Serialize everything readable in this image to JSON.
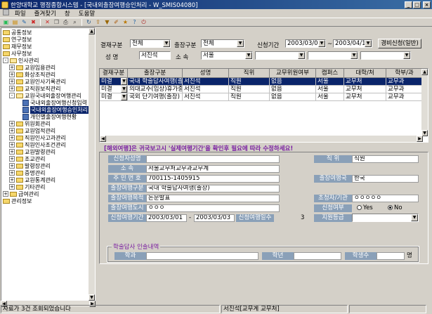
{
  "window": {
    "title": "한양대학교 행정종합시스템 - [국내외출장여행승인처리 - W_SMIS04080]"
  },
  "menu": {
    "items": [
      "파일",
      "즐겨찾기",
      "창",
      "도움말"
    ]
  },
  "toolbar": {
    "icons": [
      "new-icon",
      "open-icon",
      "pencil-icon",
      "delete-icon",
      "close-icon",
      "copy-icon",
      "print-icon",
      "search-icon",
      "refresh-icon",
      "export-icon",
      "filter-icon",
      "edit-icon",
      "bookmark-icon",
      "help-icon",
      "exit-icon"
    ]
  },
  "tree": {
    "items": [
      {
        "label": "공통정보",
        "level": 0,
        "kind": "folder",
        "expander": ""
      },
      {
        "label": "연구정보",
        "level": 0,
        "kind": "folder",
        "expander": ""
      },
      {
        "label": "재무정보",
        "level": 0,
        "kind": "folder",
        "expander": ""
      },
      {
        "label": "사무정보",
        "level": 0,
        "kind": "folder",
        "expander": ""
      },
      {
        "label": "인사관리",
        "level": 0,
        "kind": "folder-open",
        "expander": "-"
      },
      {
        "label": "교원임용관리",
        "level": 1,
        "kind": "folder",
        "expander": "+"
      },
      {
        "label": "화상조직관리",
        "level": 1,
        "kind": "folder",
        "expander": "+"
      },
      {
        "label": "교원인사기록관리",
        "level": 1,
        "kind": "folder",
        "expander": "+"
      },
      {
        "label": "교직원보직관리",
        "level": 1,
        "kind": "folder",
        "expander": "+"
      },
      {
        "label": "교원국내외출장여행관리",
        "level": 1,
        "kind": "folder-open",
        "expander": "-"
      },
      {
        "label": "국내외출장여행신청입력",
        "level": 2,
        "kind": "doc",
        "expander": ""
      },
      {
        "label": "국내외출장여행승인처리",
        "level": 2,
        "kind": "doc",
        "expander": "",
        "selected": true
      },
      {
        "label": "개인별출장여행현황",
        "level": 2,
        "kind": "doc",
        "expander": ""
      },
      {
        "label": "위원회관리",
        "level": 1,
        "kind": "folder",
        "expander": "+"
      },
      {
        "label": "교원업적관리",
        "level": 1,
        "kind": "folder",
        "expander": "+"
      },
      {
        "label": "직원인사고과관리",
        "level": 1,
        "kind": "folder",
        "expander": "+"
      },
      {
        "label": "직원인사조건관리",
        "level": 1,
        "kind": "folder",
        "expander": "+"
      },
      {
        "label": "교원발령관리",
        "level": 1,
        "kind": "folder",
        "expander": "+"
      },
      {
        "label": "조교관리",
        "level": 1,
        "kind": "folder",
        "expander": "+"
      },
      {
        "label": "발령장관리",
        "level": 1,
        "kind": "folder",
        "expander": "+"
      },
      {
        "label": "증명관리",
        "level": 1,
        "kind": "folder",
        "expander": "+"
      },
      {
        "label": "교원통계관리",
        "level": 1,
        "kind": "folder",
        "expander": "+"
      },
      {
        "label": "기타관리",
        "level": 1,
        "kind": "folder",
        "expander": "+"
      },
      {
        "label": "급여관리",
        "level": 0,
        "kind": "folder",
        "expander": "+"
      },
      {
        "label": "관리정보",
        "level": 0,
        "kind": "folder",
        "expander": ""
      }
    ]
  },
  "filters": {
    "approval_label": "결재구분",
    "approval_value": "전체",
    "trip_type_label": "출장구분",
    "trip_type_value": "전체",
    "period_label": "신청기간",
    "date_from": "2003/03/01",
    "date_to": "2003/04/10",
    "tilde": "~",
    "name_label": "성    명",
    "name_value": "서진석",
    "dept_label": "소    속",
    "dept_value": "서울",
    "expense_button": "경비신청(일반)"
  },
  "grid": {
    "headers": [
      "결재구분",
      "출장구분",
      "성명",
      "직위",
      "교무위원여부",
      "캠퍼스",
      "대학/처",
      "학부/과"
    ],
    "rows": [
      [
        "미결",
        "국내 학술답사여행(출장)",
        "서진석",
        "직원",
        "없음",
        "서울",
        "교무처",
        "교무과"
      ],
      [
        "미결",
        "의대교수(임상)휴가중 국",
        "서진석",
        "직원",
        "없음",
        "서울",
        "교무처",
        "교무과"
      ],
      [
        "미결",
        "국외 단기여행(출장)",
        "서진석",
        "직원",
        "없음",
        "서울",
        "교무처",
        "교무과"
      ]
    ]
  },
  "notice": "[해외여행]은 귀국보고시 '실제여행기간'을 확인후 필요에 따라 수정하세요!",
  "detail": {
    "applicant_label": "신청자성명",
    "position_label": "직      위",
    "position_value": "직원",
    "affil_label": "소      속",
    "affil_value": "서울교무처교무과교무계",
    "id_label": "주 민 번 호",
    "id_value": "700115-1405915",
    "dest_country_label": "출장여행국",
    "dest_country_value": "한국",
    "category_label": "출장여행구분",
    "category_value": "국내 학술답사여행(출장)",
    "purpose_label": "출장여행목적",
    "purpose_value": "논문발표",
    "host_label": "초청자/기관",
    "host_value": "ㅇㅇㅇㅇㅇ",
    "city_label": "출장여행도시",
    "city_value": "ㅇㅇㅇ",
    "application_label": "신청여부",
    "yes_label": "Yes",
    "no_label": "No",
    "period_label": "신청여행기간",
    "period_from": "2003/03/01",
    "period_dash": "-",
    "period_to": "2003/03/03",
    "days_label": "신청여행일수",
    "days_value": "3",
    "support_label": "지원등급",
    "group_title": "학술답사 인솔내역",
    "dept_label": "학과",
    "year_label": "학년",
    "students_label": "학생수",
    "students_unit": "명"
  },
  "status": {
    "left": "자료가 3건 조회되었습니다",
    "right": "서진석[교무계 교무처]"
  },
  "colors": {
    "titlebar": "#0a246a",
    "label_box": "#8aa0b8",
    "notice": "#7a1fa2",
    "selected_row": "#0a246a"
  }
}
